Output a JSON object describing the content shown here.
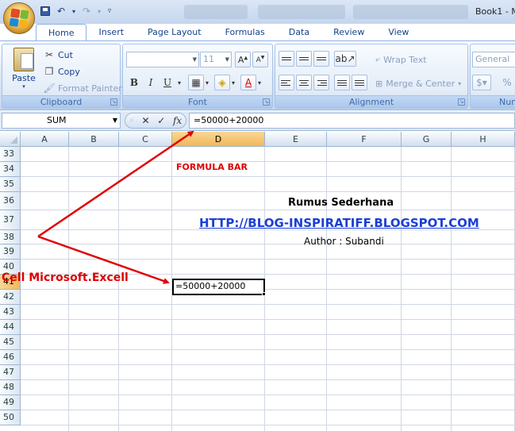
{
  "window": {
    "title": "Book1 - M"
  },
  "ribbon": {
    "tabs": [
      {
        "label": "Home",
        "active": true
      },
      {
        "label": "Insert"
      },
      {
        "label": "Page Layout"
      },
      {
        "label": "Formulas"
      },
      {
        "label": "Data"
      },
      {
        "label": "Review"
      },
      {
        "label": "View"
      }
    ],
    "clipboard": {
      "label": "Clipboard",
      "paste": "Paste",
      "cut": "Cut",
      "copy": "Copy",
      "format_painter": "Format Painter"
    },
    "font": {
      "label": "Font",
      "font_name": "",
      "font_size": "11",
      "bold": "B",
      "italic": "I",
      "underline": "U"
    },
    "alignment": {
      "label": "Alignment",
      "wrap_text": "Wrap Text",
      "merge_center": "Merge & Center"
    },
    "number": {
      "label": "Num",
      "format": "General",
      "percent": "%"
    }
  },
  "formula_bar": {
    "name_box": "SUM",
    "cancel": "✕",
    "enter": "✓",
    "fx": "fx",
    "value": "=50000+20000"
  },
  "grid": {
    "columns": [
      "A",
      "B",
      "C",
      "D",
      "E",
      "F",
      "G",
      "H"
    ],
    "selected_column": "D",
    "rows": [
      "33",
      "34",
      "35",
      "36",
      "37",
      "38",
      "39",
      "40",
      "41",
      "42",
      "43",
      "44",
      "45",
      "46",
      "47",
      "48",
      "49",
      "50"
    ],
    "selected_row": "41",
    "active_cell": {
      "ref": "D41",
      "value": "=50000+20000"
    }
  },
  "annotations": {
    "formula_bar_label": "FORMULA BAR",
    "title": "Rumus Sederhana",
    "blog_url": "HTTP://BLOG-INSPIRATIFF.BLOGSPOT.COM",
    "author": "Author : Subandi",
    "cell_label": "Cell Microsoft.Excell",
    "arrow_color": "#e00000"
  },
  "colors": {
    "accent_red": "#e00000",
    "link_blue": "#1a3fd6",
    "ribbon_text": "#15428b"
  }
}
